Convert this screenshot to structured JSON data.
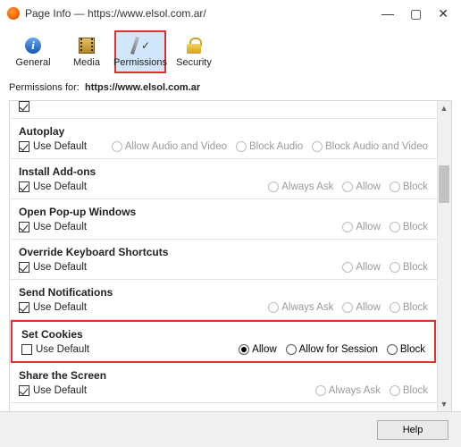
{
  "window": {
    "title": "Page Info — https://www.elsol.com.ar/",
    "minimize": "—",
    "maximize": "▢",
    "close": "✕"
  },
  "toolbar": {
    "general": "General",
    "media": "Media",
    "permissions": "Permissions",
    "security": "Security"
  },
  "subheader": {
    "label": "Permissions for:",
    "url": "https://www.elsol.com.ar"
  },
  "labels": {
    "use_default": "Use Default",
    "allow": "Allow",
    "block": "Block",
    "always_ask": "Always Ask",
    "allow_for_session": "Allow for Session",
    "allow_audio_video": "Allow Audio and Video",
    "block_audio": "Block Audio",
    "block_audio_video": "Block Audio and Video"
  },
  "sections": {
    "autoplay": "Autoplay",
    "install_addons": "Install Add-ons",
    "popup": "Open Pop-up Windows",
    "override_kb": "Override Keyboard Shortcuts",
    "send_notif": "Send Notifications",
    "set_cookies": "Set Cookies",
    "share_screen": "Share the Screen"
  },
  "footer": {
    "help": "Help"
  }
}
